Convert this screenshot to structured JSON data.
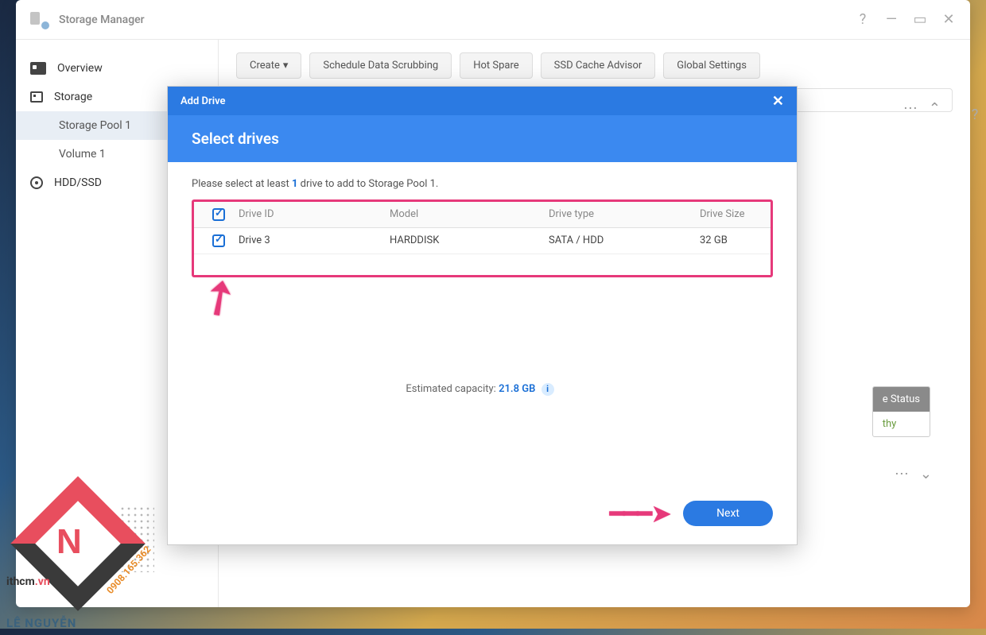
{
  "app": {
    "title": "Storage Manager"
  },
  "sidebar": {
    "overview": "Overview",
    "storage": "Storage",
    "pool": "Storage Pool 1",
    "volume": "Volume 1",
    "hdd": "HDD/SSD"
  },
  "toolbar": {
    "create": "Create",
    "scrub": "Schedule Data Scrubbing",
    "hotspare": "Hot Spare",
    "ssd": "SSD Cache Advisor",
    "global": "Global Settings"
  },
  "status": {
    "header": "e Status",
    "value": "thy"
  },
  "modal": {
    "title": "Add Drive",
    "heading": "Select drives",
    "instruction_pre": "Please select at least ",
    "instruction_num": "1",
    "instruction_post": " drive to add to Storage Pool 1.",
    "columns": {
      "id": "Drive ID",
      "model": "Model",
      "type": "Drive type",
      "size": "Drive Size"
    },
    "rows": [
      {
        "id": "Drive 3",
        "model": "HARDDISK",
        "type": "SATA / HDD",
        "size": "32 GB"
      }
    ],
    "capacity_label": "Estimated capacity: ",
    "capacity_value": "21.8 GB",
    "next": "Next"
  },
  "watermark": {
    "brand": "LÊ NGUYỄN",
    "site_a": "ithcm",
    "site_b": ".vn",
    "phone": "0908.165.362"
  }
}
